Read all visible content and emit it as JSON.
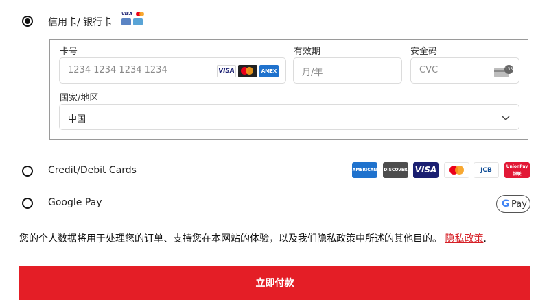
{
  "payment_options": {
    "card_cn": {
      "label": "信用卡/ 银行卡",
      "selected": true
    },
    "credit_debit": {
      "label": "Credit/Debit Cards",
      "selected": false
    },
    "google_pay": {
      "label": "Google Pay",
      "selected": false
    }
  },
  "card_form": {
    "card_number": {
      "label": "卡号",
      "placeholder": "1234 1234 1234 1234"
    },
    "expiry": {
      "label": "有效期",
      "placeholder": "月/年"
    },
    "cvc": {
      "label": "安全码",
      "placeholder": "CVC",
      "icon_number": "135"
    },
    "country": {
      "label": "国家/地区",
      "value": "中国"
    }
  },
  "card_badges": {
    "visa": "VISA",
    "amex": "AMEX"
  },
  "brands": {
    "amex": "AMERICAN EXPRESS",
    "discover": "DISCOVER",
    "visa": "VISA",
    "jcb": "JCB",
    "unionpay": "UnionPay 银联"
  },
  "gpay": {
    "g": "G",
    "text": "Pay"
  },
  "privacy": {
    "text": "您的个人数据将用于处理您的订单、支持您在本网站的体验，以及我们隐私政策中所述的其他目的。",
    "link": "隐私政策",
    "tail": "."
  },
  "submit_label": "立即付款",
  "colors": {
    "accent": "#e41e26",
    "link": "#d61f26"
  }
}
